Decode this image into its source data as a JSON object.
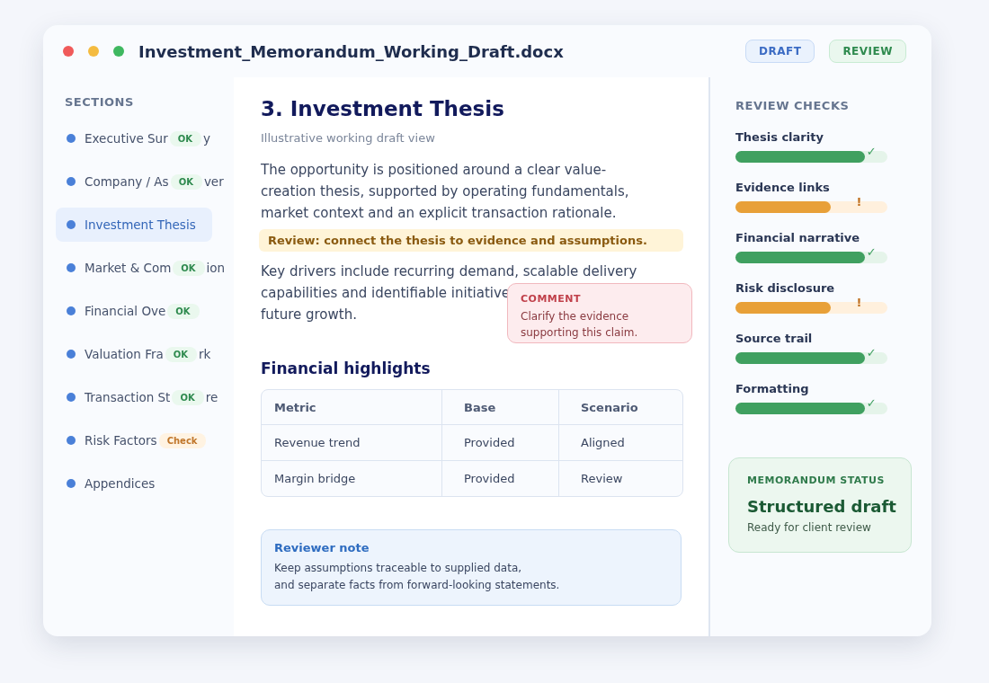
{
  "window": {
    "title": "Investment_Memorandum_Working_Draft.docx",
    "controls": [
      {
        "kind": "close"
      },
      {
        "kind": "minimize"
      },
      {
        "kind": "maximize"
      }
    ],
    "tags": [
      {
        "text": "DRAFT",
        "kind": "info"
      },
      {
        "text": "REVIEW",
        "kind": "ok"
      }
    ]
  },
  "sidebar": {
    "heading": "SECTIONS",
    "items": [
      {
        "label": "Executive Sur",
        "badge": {
          "text": "OK",
          "kind": "ok"
        },
        "tail": "y",
        "selected": false
      },
      {
        "label": "Company / As",
        "badge": {
          "text": "OK",
          "kind": "ok"
        },
        "tail": "ver",
        "selected": false
      },
      {
        "label": "Investment Thesis",
        "selected": true
      },
      {
        "label": "Market & Com",
        "badge": {
          "text": "OK",
          "kind": "ok"
        },
        "tail": "ion",
        "selected": false
      },
      {
        "label": "Financial Ove",
        "badge": {
          "text": "OK",
          "kind": "ok"
        },
        "selected": false
      },
      {
        "label": "Valuation Fra",
        "badge": {
          "text": "OK",
          "kind": "ok"
        },
        "tail": "rk",
        "selected": false
      },
      {
        "label": "Transaction St",
        "badge": {
          "text": "OK",
          "kind": "ok"
        },
        "tail": "re",
        "selected": false
      },
      {
        "label": "Risk Factors",
        "badge": {
          "text": "Check",
          "kind": "warn"
        },
        "selected": false
      },
      {
        "label": "Appendices",
        "selected": false
      }
    ]
  },
  "document": {
    "heading": "3. Investment Thesis",
    "subtitle": "Illustrative working draft view",
    "paragraph_1": "The opportunity is positioned around a clear value-creation thesis, supported by operating fundamentals, market context and an explicit transaction rationale.",
    "review_highlight": "Review: connect the thesis to evidence and assumptions.",
    "paragraph_2_lines": [
      "Key drivers include recurring demand, scalable delivery",
      "capabilities and identifiable initiative",
      "future growth."
    ],
    "comment": {
      "label": "COMMENT",
      "text": "Clarify the evidence supporting this claim."
    },
    "table_heading": "Financial highlights",
    "table": {
      "columns": [
        "Metric",
        "Base",
        "Scenario"
      ],
      "rows": [
        [
          "Revenue trend",
          "Provided",
          "Aligned"
        ],
        [
          "Margin bridge",
          "Provided",
          "Review"
        ]
      ]
    },
    "reviewer_note": {
      "title": "Reviewer note",
      "lines": [
        "Keep assumptions traceable to supplied data,",
        "and separate facts from forward-looking statements."
      ]
    }
  },
  "review_checks": {
    "heading": "REVIEW CHECKS",
    "items": [
      {
        "label": "Thesis clarity",
        "kind": "ok",
        "mark": "✓",
        "level": 0.85
      },
      {
        "label": "Evidence links",
        "kind": "warn",
        "mark": "!",
        "level": 0.63
      },
      {
        "label": "Financial narrative",
        "kind": "ok",
        "mark": "✓",
        "level": 0.85
      },
      {
        "label": "Risk disclosure",
        "kind": "warn",
        "mark": "!",
        "level": 0.63
      },
      {
        "label": "Source trail",
        "kind": "ok",
        "mark": "✓",
        "level": 0.85
      },
      {
        "label": "Formatting",
        "kind": "ok",
        "mark": "✓",
        "level": 0.85
      }
    ]
  },
  "status": {
    "label": "MEMORANDUM STATUS",
    "value": "Structured draft",
    "note": "Ready for client review"
  }
}
